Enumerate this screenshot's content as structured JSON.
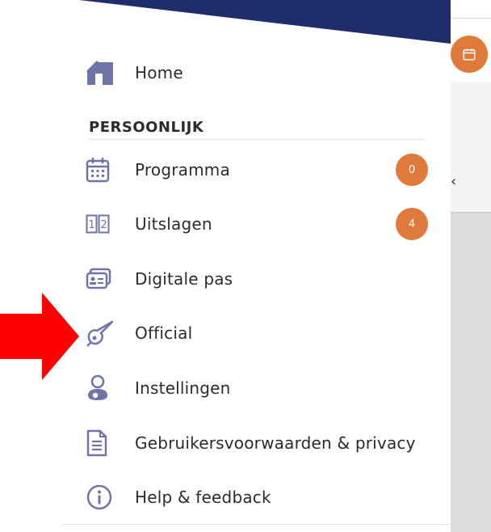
{
  "drawer": {
    "home": {
      "label": "Home",
      "icon": "home-icon"
    },
    "section": {
      "title": "PERSOONLIJK"
    },
    "items": [
      {
        "label": "Programma",
        "icon": "calendar-icon",
        "badge": "0"
      },
      {
        "label": "Uitslagen",
        "icon": "scoreboard-icon",
        "badge": "4"
      },
      {
        "label": "Digitale pas",
        "icon": "id-card-icon",
        "badge": ""
      },
      {
        "label": "Official",
        "icon": "whistle-icon",
        "badge": ""
      },
      {
        "label": "Instellingen",
        "icon": "user-settings-icon",
        "badge": ""
      },
      {
        "label": "Gebruikersvoorwaarden & privacy",
        "icon": "document-icon",
        "badge": ""
      },
      {
        "label": "Help & feedback",
        "icon": "info-icon",
        "badge": ""
      }
    ]
  },
  "background": {
    "chevron": "‹"
  },
  "colors": {
    "accent": "#e07a3b",
    "icon": "#6f74a8",
    "header": "#1f2d6b",
    "annotation_arrow": "#ff0000"
  }
}
